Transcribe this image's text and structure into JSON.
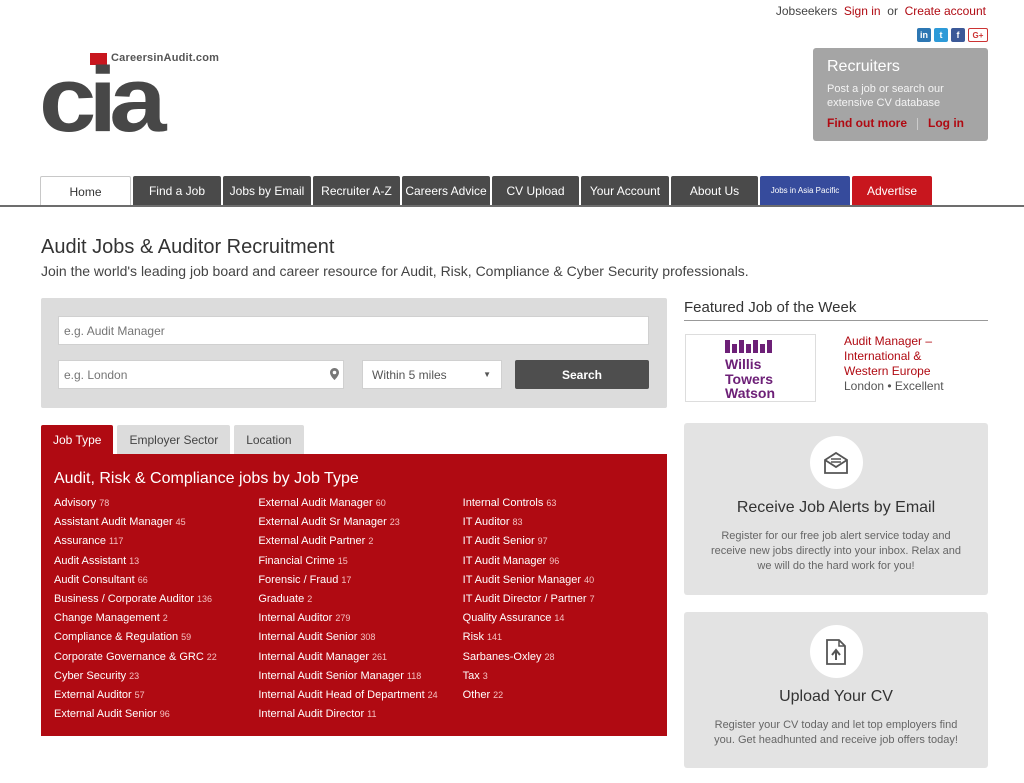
{
  "topbar": {
    "jobseekers": "Jobseekers",
    "sign_in": "Sign in",
    "or": "or",
    "create_account": "Create account"
  },
  "social": [
    {
      "icon": "linkedin-icon",
      "glyph": "in"
    },
    {
      "icon": "twitter-icon",
      "glyph": "t"
    },
    {
      "icon": "facebook-icon",
      "glyph": "f"
    },
    {
      "icon": "googleplus-icon",
      "glyph": "G+"
    }
  ],
  "logo": {
    "text": "cia",
    "site": "CareersinAudit.com"
  },
  "recruiters": {
    "title": "Recruiters",
    "text": "Post a job or search our extensive CV database",
    "find_out_more": "Find out more",
    "log_in": "Log in"
  },
  "nav": [
    "Home",
    "Find a Job",
    "Jobs by Email",
    "Recruiter A-Z",
    "Careers Advice",
    "CV Upload",
    "Your Account",
    "About Us",
    "Jobs in Asia Pacific",
    "Advertise"
  ],
  "page": {
    "title": "Audit Jobs & Auditor Recruitment",
    "subtitle": "Join the world's leading job board and career resource for Audit, Risk, Compliance & Cyber Security professionals."
  },
  "search": {
    "keyword_placeholder": "e.g. Audit Manager",
    "location_placeholder": "e.g. London",
    "radius": "Within 5 miles",
    "button": "Search"
  },
  "job_tabs": [
    "Job Type",
    "Employer Sector",
    "Location"
  ],
  "job_types": {
    "heading": "Audit, Risk & Compliance jobs by Job Type",
    "columns": [
      [
        [
          "Advisory",
          "78"
        ],
        [
          "Assistant Audit Manager",
          "45"
        ],
        [
          "Assurance",
          "117"
        ],
        [
          "Audit Assistant",
          "13"
        ],
        [
          "Audit Consultant",
          "66"
        ],
        [
          "Business / Corporate Auditor",
          "136"
        ],
        [
          "Change Management",
          "2"
        ],
        [
          "Compliance & Regulation",
          "59"
        ],
        [
          "Corporate Governance & GRC",
          "22"
        ],
        [
          "Cyber Security",
          "23"
        ],
        [
          "External Auditor",
          "57"
        ],
        [
          "External Audit Senior",
          "96"
        ]
      ],
      [
        [
          "External Audit Manager",
          "60"
        ],
        [
          "External Audit Sr Manager",
          "23"
        ],
        [
          "External Audit Partner",
          "2"
        ],
        [
          "Financial Crime",
          "15"
        ],
        [
          "Forensic / Fraud",
          "17"
        ],
        [
          "Graduate",
          "2"
        ],
        [
          "Internal Auditor",
          "279"
        ],
        [
          "Internal Audit Senior",
          "308"
        ],
        [
          "Internal Audit Manager",
          "261"
        ],
        [
          "Internal Audit Senior Manager",
          "118"
        ],
        [
          "Internal Audit Head of Department",
          "24"
        ],
        [
          "Internal Audit Director",
          "11"
        ]
      ],
      [
        [
          "Internal Controls",
          "63"
        ],
        [
          "IT Auditor",
          "83"
        ],
        [
          "IT Audit Senior",
          "97"
        ],
        [
          "IT Audit Manager",
          "96"
        ],
        [
          "IT Audit Senior Manager",
          "40"
        ],
        [
          "IT Audit Director / Partner",
          "7"
        ],
        [
          "Quality Assurance",
          "14"
        ],
        [
          "Risk",
          "141"
        ],
        [
          "Sarbanes-Oxley",
          "28"
        ],
        [
          "Tax",
          "3"
        ],
        [
          "Other",
          "22"
        ]
      ]
    ]
  },
  "featured": {
    "heading": "Featured Job of the Week",
    "logo_lines": [
      "Willis",
      "Towers",
      "Watson"
    ],
    "job_title": "Audit Manager – International & Western Europe",
    "meta": "London • Excellent"
  },
  "alerts": {
    "title": "Receive Job Alerts by Email",
    "text": "Register for our free job alert service today and receive new jobs directly into your inbox. Relax and we will do the hard work for you!"
  },
  "upload": {
    "title": "Upload Your CV",
    "text": "Register your CV today and let top employers find you. Get headhunted and receive job offers today!"
  },
  "colors": {
    "brand_red": "#b00a12",
    "nav_dark": "#4a4a4a",
    "asia_blue": "#364b9c",
    "wtw_purple": "#6d2077"
  }
}
